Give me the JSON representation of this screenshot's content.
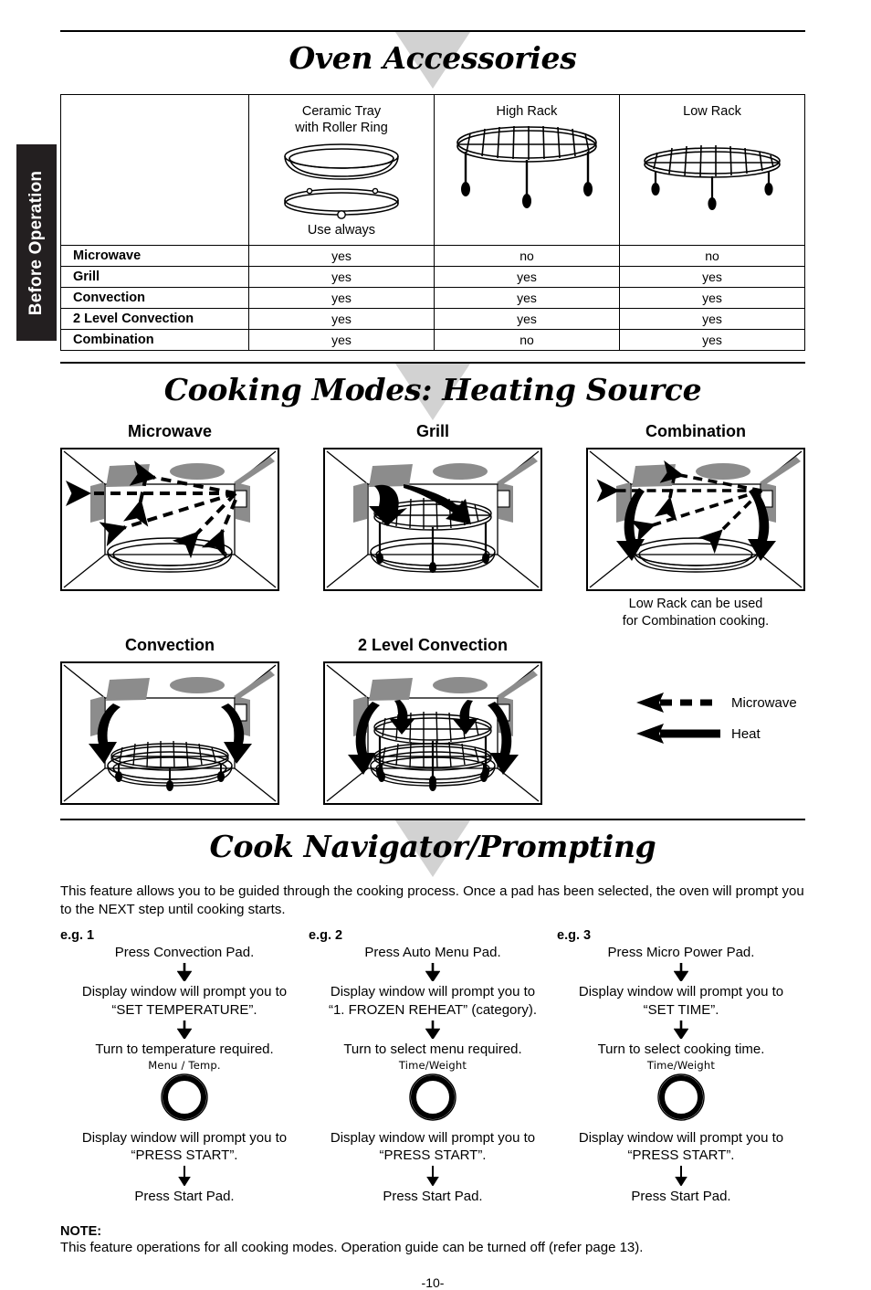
{
  "side_tab": {
    "label": "Before Operation"
  },
  "sections": {
    "accessories": {
      "title": "Oven Accessories"
    },
    "cooking_modes": {
      "title": "Cooking Modes: Heating Source"
    },
    "navigator": {
      "title": "Cook Navigator/Prompting"
    }
  },
  "accessories_table": {
    "headers": [
      "",
      "Ceramic Tray\nwith Roller Ring",
      "High Rack",
      "Low Rack"
    ],
    "header_col1_line1": "Ceramic Tray",
    "header_col1_line2": "with Roller Ring",
    "header_col2": "High Rack",
    "header_col3": "Low Rack",
    "ceramic_note": "Use always",
    "rows": [
      {
        "mode": "Microwave",
        "ceramic": "yes",
        "high": "no",
        "low": "no"
      },
      {
        "mode": "Grill",
        "ceramic": "yes",
        "high": "yes",
        "low": "yes"
      },
      {
        "mode": "Convection",
        "ceramic": "yes",
        "high": "yes",
        "low": "yes"
      },
      {
        "mode": "2 Level Convection",
        "ceramic": "yes",
        "high": "yes",
        "low": "yes"
      },
      {
        "mode": "Combination",
        "ceramic": "yes",
        "high": "no",
        "low": "yes"
      }
    ]
  },
  "cooking_modes": {
    "diagrams": [
      {
        "title": "Microwave",
        "caption": ""
      },
      {
        "title": "Grill",
        "caption": ""
      },
      {
        "title": "Combination",
        "caption_line1": "Low Rack can be used",
        "caption_line2": "for Combination cooking."
      },
      {
        "title": "Convection",
        "caption": ""
      },
      {
        "title": "2 Level Convection",
        "caption": ""
      }
    ],
    "legend": [
      {
        "icon": "dashed-arrow-left-icon",
        "label": "Microwave"
      },
      {
        "icon": "solid-arrow-left-icon",
        "label": "Heat"
      }
    ]
  },
  "navigator": {
    "intro": "This feature allows you to be guided through the cooking process. Once a pad has been selected, the oven will prompt you to the NEXT step until cooking starts.",
    "examples": [
      {
        "label": "e.g. 1",
        "step1": "Press Convection Pad.",
        "step2_line1": "Display window will prompt you to",
        "step2_line2": "“SET TEMPERATURE”.",
        "step3": "Turn to temperature required.",
        "dial_label": "Menu / Temp.",
        "step4_line1": "Display window will prompt you to",
        "step4_line2": "“PRESS START”.",
        "step5": "Press Start Pad."
      },
      {
        "label": "e.g. 2",
        "step1": "Press Auto Menu Pad.",
        "step2_line1": "Display window will prompt you to",
        "step2_line2": "“1. FROZEN REHEAT” (category).",
        "step3": "Turn to select menu required.",
        "dial_label": "Time/Weight",
        "step4_line1": "Display window will prompt you to",
        "step4_line2": "“PRESS START”.",
        "step5": "Press Start Pad."
      },
      {
        "label": "e.g. 3",
        "step1": "Press Micro Power Pad.",
        "step2_line1": "Display window will prompt you to",
        "step2_line2": "“SET TIME”.",
        "step3": "Turn to select cooking time.",
        "dial_label": "Time/Weight",
        "step4_line1": "Display window will prompt you to",
        "step4_line2": "“PRESS START”.",
        "step5": "Press Start Pad."
      }
    ]
  },
  "note": {
    "title": "NOTE:",
    "body": "This feature operations for all cooking modes. Operation guide can be turned off (refer page 13)."
  },
  "page_number": "-10-",
  "colors": {
    "ink": "#000000",
    "tab_background": "#231f20",
    "triangle_watermark": "#d2d2d2",
    "oven_shading": "#8c8c8c"
  }
}
